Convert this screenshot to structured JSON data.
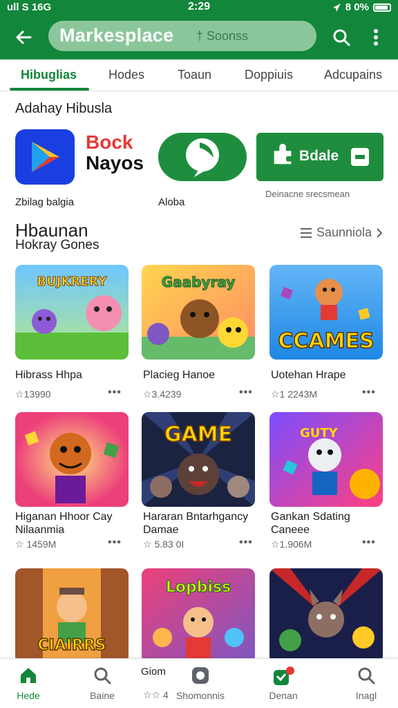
{
  "status_bar": {
    "signal": "ull S",
    "network": "16G",
    "time": "2:29",
    "battery": "8 0%"
  },
  "app_bar": {
    "title": "Markesplace",
    "search_placeholder": "† Soonss"
  },
  "tabs": [
    "Hibuglias",
    "Hodes",
    "Toaun",
    "Doppiuis",
    "Adcupains"
  ],
  "featured": {
    "heading": "Adahay Hibusla",
    "items": [
      {
        "label": "Zbilag balgia"
      },
      {
        "wordmark_top": "Bock",
        "wordmark_bottom": "Nayos"
      },
      {
        "label": "Aloba"
      },
      {
        "button_text": "Bdale",
        "caption": "Deinacne  srecsmean"
      }
    ]
  },
  "section": {
    "title": "Hbaunan",
    "subtitle": "Hokray Gones",
    "see_all": "Saunniola"
  },
  "games": [
    {
      "name": "Hibrass Hhpa",
      "rating": "☆13990",
      "art_text": "BUJKRERY"
    },
    {
      "name": "Placieg Hanoe",
      "rating": "☆3.4239",
      "art_text": "Gaabyray"
    },
    {
      "name": "Uotehan Hrape",
      "rating": "☆1 2243M",
      "art_text": "CCAMES"
    },
    {
      "name": "Higanan Hhoor Cay Nilaanmia",
      "rating": "☆ 1459M",
      "art_text": ""
    },
    {
      "name": "Hararan Bntarhgancy Damae",
      "rating": "☆ 5.83 0I",
      "art_text": "GAME"
    },
    {
      "name": "Gankan Sdating Caneee",
      "rating": "☆1.906M",
      "art_text": "GUTY"
    },
    {
      "name": "",
      "rating": "",
      "art_text": "CIAIRRS"
    },
    {
      "name": "",
      "rating": "",
      "art_text": "Lopbiss"
    },
    {
      "name": "",
      "rating": "",
      "art_text": ""
    }
  ],
  "more_label": "•••",
  "bottom_nav": [
    {
      "label": "Hede"
    },
    {
      "label": "Baine"
    },
    {
      "label": "Shomonnis"
    },
    {
      "label": "Denan",
      "badge": "!"
    },
    {
      "label": "Inagl"
    }
  ],
  "bottom_nav_extra": {
    "top": "Giom",
    "rating": "☆☆ 4"
  },
  "colors": {
    "brand": "#12863a",
    "search_bg": "#8bc69b",
    "text": "#202124",
    "muted": "#5f6368"
  }
}
